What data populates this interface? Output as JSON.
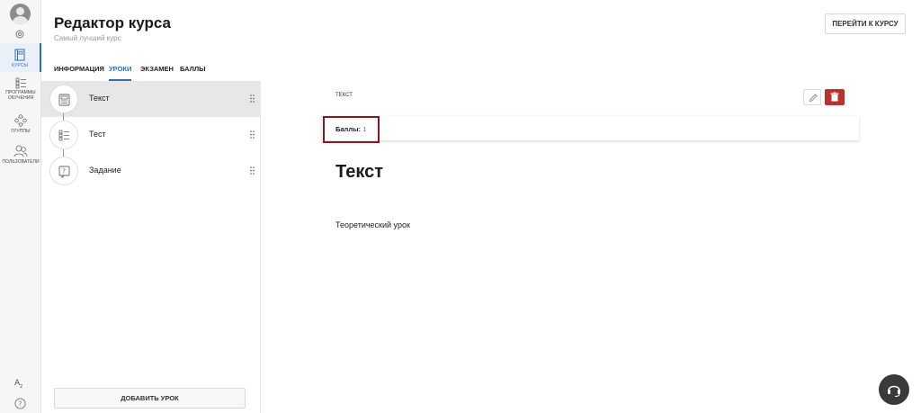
{
  "nav": {
    "items": [
      {
        "label": "КУРСЫ"
      },
      {
        "label_line1": "ПРОГРАММЫ",
        "label_line2": "ОБУЧЕНИЯ"
      },
      {
        "label": "ГРУППЫ"
      },
      {
        "label": "ПОЛЬЗОВАТЕЛИ"
      }
    ]
  },
  "header": {
    "title": "Редактор курса",
    "subtitle": "Самый лучший курс",
    "go_button": "ПЕРЕЙТИ К КУРСУ"
  },
  "tabs": [
    {
      "label": "ИНФОРМАЦИЯ"
    },
    {
      "label": "УРОКИ"
    },
    {
      "label": "ЭКЗАМЕН"
    },
    {
      "label": "БАЛЛЫ"
    }
  ],
  "lessons": [
    {
      "name": "Текст",
      "icon": "document-icon"
    },
    {
      "name": "Тест",
      "icon": "checklist-icon"
    },
    {
      "name": "Задание",
      "icon": "question-icon"
    }
  ],
  "add_lesson_button": "ДОБАВИТЬ УРОК",
  "content": {
    "type_label": "ТЕКСТ",
    "score_label": "Баллы:",
    "score_value": "1",
    "heading": "Текст",
    "body": "Теоретический урок"
  },
  "colors": {
    "accent": "#2f6db5",
    "delete": "#b8332e",
    "highlight": "#8b1720"
  }
}
